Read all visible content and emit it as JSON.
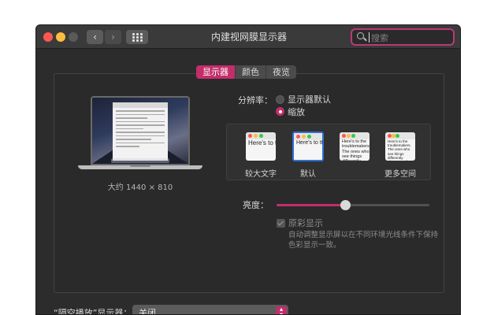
{
  "window": {
    "title": "内建视网膜显示器",
    "nav_back_icon": "‹",
    "nav_forward_icon": "›",
    "search_placeholder": "搜索"
  },
  "tabs": [
    {
      "label": "显示器",
      "active": true
    },
    {
      "label": "颜色",
      "active": false
    },
    {
      "label": "夜览",
      "active": false
    }
  ],
  "display": {
    "approx_resolution": "大约 1440 × 810"
  },
  "resolution": {
    "label": "分辨率：",
    "option_default": "显示器默认",
    "option_scaled": "缩放",
    "selected": "缩放"
  },
  "scaling_options": [
    {
      "preview_text": "Here's to the troublemakers",
      "label": "较大文字",
      "selected": false
    },
    {
      "preview_text": "Here's to the troublemakers. The ones who see things",
      "label": "默认",
      "selected": true
    },
    {
      "preview_text": "Here's to the troublemakers. The ones who see things differently. rules. And",
      "label": "",
      "selected": false
    },
    {
      "preview_text": "Here's to the troublemakers. The ones who see things differently. They're not fond of rules. And they",
      "label": "更多空间",
      "selected": false
    }
  ],
  "brightness": {
    "label": "亮度：",
    "value": 0.45
  },
  "true_tone": {
    "label": "原彩显示",
    "checked": true,
    "enabled": false,
    "description": "自动调整显示屏以在不同环境光线条件下保持色彩显示一致。"
  },
  "airplay": {
    "label": "“隔空播放”显示器：",
    "value": "关闭"
  },
  "colors": {
    "accent": "#c22e6a",
    "window_bg": "#2c2c2c",
    "selection_blue": "#2f6fd6"
  }
}
